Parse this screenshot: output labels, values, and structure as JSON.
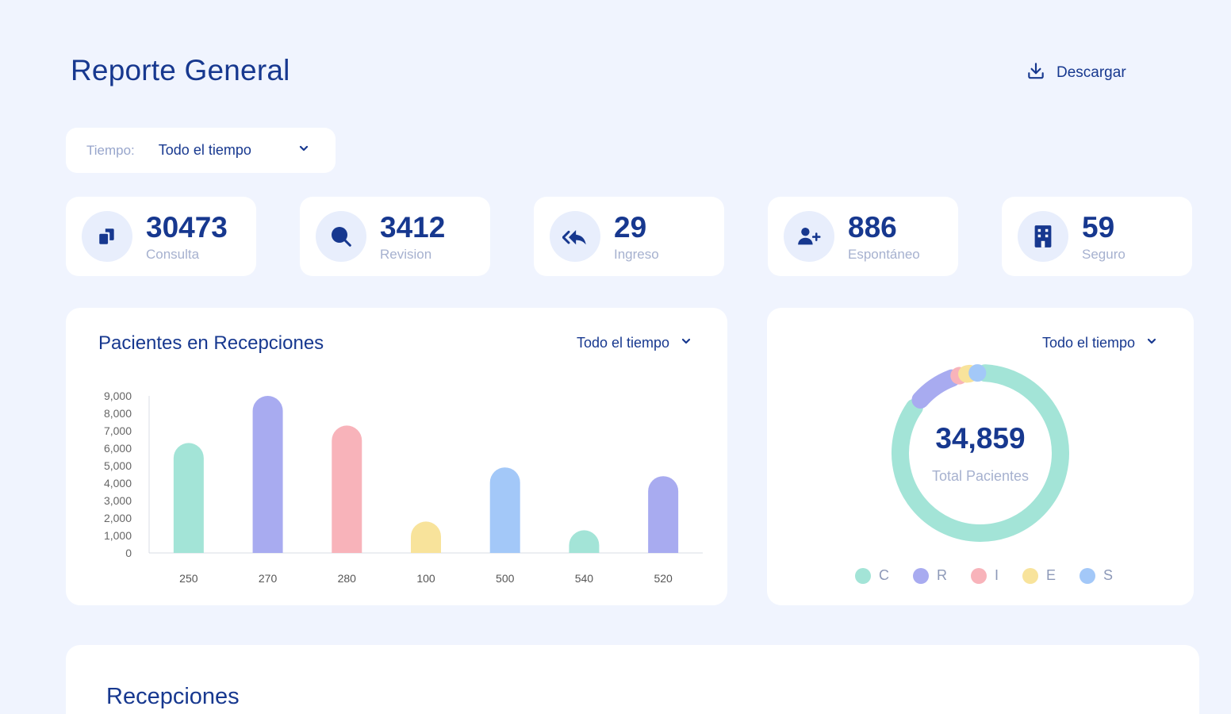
{
  "header": {
    "title": "Reporte General",
    "download_label": "Descargar"
  },
  "filter": {
    "label": "Tiempo:",
    "value": "Todo el tiempo"
  },
  "stats": [
    {
      "value": "30473",
      "label": "Consulta",
      "icon": "documents-icon"
    },
    {
      "value": "3412",
      "label": "Revision",
      "icon": "search-icon"
    },
    {
      "value": "29",
      "label": "Ingreso",
      "icon": "reply-all-icon"
    },
    {
      "value": "886",
      "label": "Espontáneo",
      "icon": "user-plus-icon"
    },
    {
      "value": "59",
      "label": "Seguro",
      "icon": "building-icon"
    }
  ],
  "bar_card": {
    "title": "Pacientes en Recepciones",
    "period": "Todo el tiempo"
  },
  "donut_card": {
    "period": "Todo el tiempo",
    "total": "34,859",
    "total_label": "Total Pacientes"
  },
  "recepciones": {
    "title": "Recepciones"
  },
  "colors": {
    "teal": "#a3e4d7",
    "purple": "#a8abf0",
    "pink": "#f8b3ba",
    "yellow": "#f8e39b",
    "blue": "#a3c8f8",
    "navy": "#17388f"
  },
  "chart_data": [
    {
      "type": "bar",
      "title": "Pacientes en Recepciones",
      "categories": [
        "250",
        "270",
        "280",
        "100",
        "500",
        "540",
        "520"
      ],
      "values": [
        6300,
        9000,
        7300,
        1800,
        4900,
        1300,
        4400
      ],
      "colors": [
        "#a3e4d7",
        "#a8abf0",
        "#f8b3ba",
        "#f8e39b",
        "#a3c8f8",
        "#a3e4d7",
        "#a8abf0"
      ],
      "ylim": [
        0,
        9000
      ],
      "yticks": [
        "0",
        "1,000",
        "2,000",
        "3,000",
        "4,000",
        "5,000",
        "6,000",
        "7,000",
        "8,000",
        "9,000"
      ],
      "grid": false
    },
    {
      "type": "pie",
      "variant": "donut",
      "labels": [
        "C",
        "R",
        "I",
        "E",
        "S"
      ],
      "values": [
        30473,
        3412,
        29,
        886,
        59
      ],
      "colors": [
        "#a3e4d7",
        "#a8abf0",
        "#f8b3ba",
        "#f8e39b",
        "#a3c8f8"
      ],
      "legend": "bottom"
    }
  ]
}
